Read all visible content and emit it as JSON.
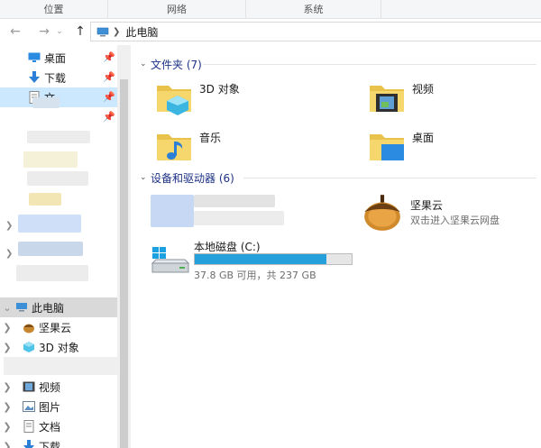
{
  "ribbon": {
    "groups": [
      {
        "label": "位置"
      },
      {
        "label": "网络"
      },
      {
        "label": "系统"
      },
      {
        "label": ""
      }
    ]
  },
  "address": {
    "crumb": "此电脑"
  },
  "nav": {
    "quick_access": [
      {
        "label": "桌面",
        "icon": "desktop-icon",
        "pinned": true
      },
      {
        "label": "下载",
        "icon": "download-icon",
        "pinned": true
      },
      {
        "label": "文",
        "icon": "documents-icon",
        "pinned": true
      }
    ],
    "this_pc": {
      "label": "此电脑",
      "icon": "computer-icon"
    },
    "this_pc_children": [
      {
        "label": "坚果云",
        "icon": "nutstore-icon"
      },
      {
        "label": "3D 对象",
        "icon": "3d-objects-icon"
      },
      {
        "label": "视频",
        "icon": "videos-icon"
      },
      {
        "label": "图片",
        "icon": "pictures-icon"
      },
      {
        "label": "文档",
        "icon": "documents-icon"
      },
      {
        "label": "下载",
        "icon": "download-icon"
      }
    ]
  },
  "main": {
    "folders_header": "文件夹 (7)",
    "folders": [
      {
        "name": "3D 对象",
        "icon": "3d-objects-folder-icon"
      },
      {
        "name": "视频",
        "icon": "videos-folder-icon"
      },
      {
        "name": "音乐",
        "icon": "music-folder-icon"
      },
      {
        "name": "桌面",
        "icon": "desktop-folder-icon"
      }
    ],
    "devices_header": "设备和驱动器 (6)",
    "nutstore": {
      "name": "坚果云",
      "subtitle": "双击进入坚果云网盘"
    },
    "drive_c": {
      "name": "本地磁盘 (C:)",
      "status": "37.8 GB 可用，共 237 GB",
      "used_fraction": 0.84
    }
  },
  "colors": {
    "accent": "#26a0da",
    "section": "#1e3287",
    "selection": "#cce8ff"
  }
}
